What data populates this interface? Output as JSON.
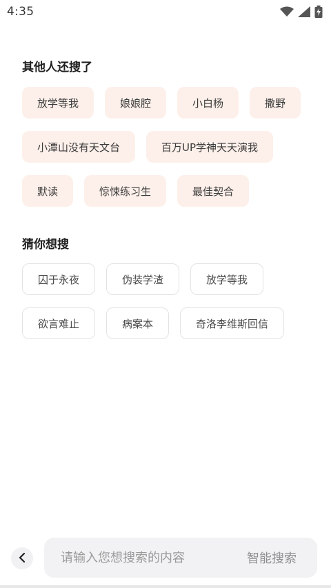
{
  "status_bar": {
    "time": "4:35",
    "icons": [
      "wifi-icon",
      "signal-icon",
      "battery-charging-icon"
    ]
  },
  "hot_searches": {
    "title": "其他人还搜了",
    "rows": [
      [
        "放学等我",
        "娘娘腔",
        "小白杨",
        "撒野"
      ],
      [
        "小潭山没有天文台",
        "百万UP学神天天演我"
      ],
      [
        "默读",
        "惊悚练习生",
        "最佳契合"
      ]
    ]
  },
  "guess_searches": {
    "title": "猜你想搜",
    "rows": [
      [
        "囚于永夜",
        "伪装学渣",
        "放学等我"
      ],
      [
        "欲言难止",
        "病案本",
        "奇洛李维斯回信"
      ]
    ]
  },
  "search_bar": {
    "placeholder": "请输入您想搜索的内容",
    "value": "",
    "submit_label": "智能搜索"
  },
  "colors": {
    "hot_chip_bg": "#fdf0ea",
    "guess_chip_border": "#e3e3e3",
    "search_bg": "#f2f2f4"
  }
}
